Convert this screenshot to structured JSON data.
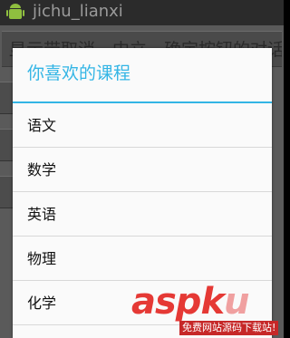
{
  "titlebar": {
    "app_name": "jichu_lianxi",
    "icon": "android-icon"
  },
  "background": {
    "button_label": "显示带取消、中立、确定按钮的对话"
  },
  "dialog": {
    "title": "你喜欢的课程",
    "accent_color": "#33b5e5",
    "items": [
      "语文",
      "数学",
      "英语",
      "物理",
      "化学"
    ]
  },
  "watermark": {
    "logo_part1": "asp",
    "logo_part2": "k",
    "logo_part3": "u",
    "logo_suffix": ".com",
    "tagline": "免费网站源码下载站!"
  }
}
